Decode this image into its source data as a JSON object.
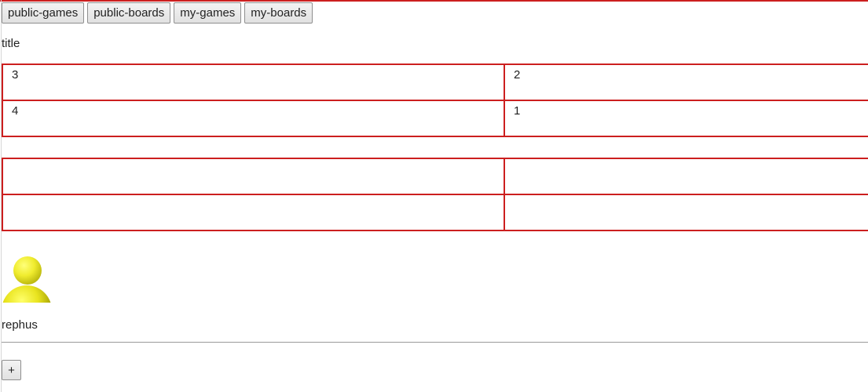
{
  "nav": {
    "buttons": [
      {
        "label": "public-games"
      },
      {
        "label": "public-boards"
      },
      {
        "label": "my-games"
      },
      {
        "label": "my-boards"
      }
    ]
  },
  "title": "title",
  "boards": [
    {
      "rows": [
        [
          "3",
          "2"
        ],
        [
          "4",
          "1"
        ]
      ]
    },
    {
      "rows": [
        [
          "",
          ""
        ],
        [
          "",
          ""
        ]
      ]
    }
  ],
  "user": {
    "name": "rephus",
    "avatar_icon": "user-avatar-icon"
  },
  "add_button": {
    "label": "+"
  },
  "colors": {
    "accent": "#cc1f1f",
    "avatar": "#e9e41f"
  }
}
